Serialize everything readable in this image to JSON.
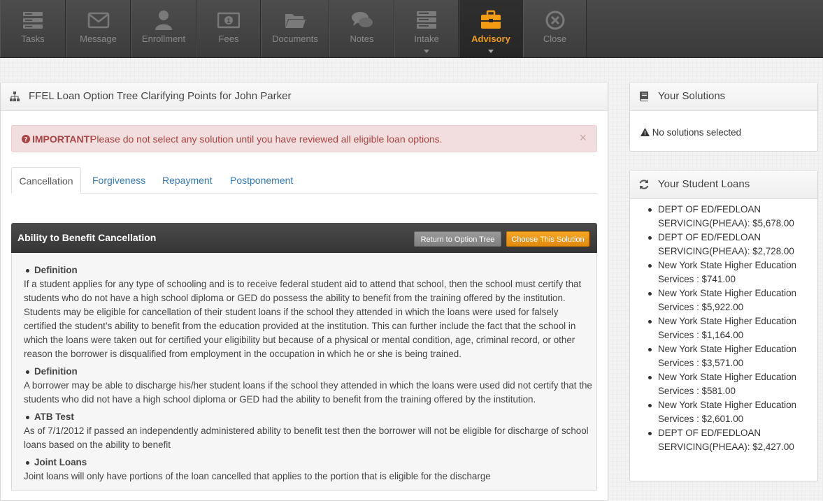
{
  "nav": {
    "items": [
      {
        "label": "Tasks",
        "icon": "tasks-icon"
      },
      {
        "label": "Message",
        "icon": "envelope-icon"
      },
      {
        "label": "Enrollment",
        "icon": "user-icon"
      },
      {
        "label": "Fees",
        "icon": "money-icon"
      },
      {
        "label": "Documents",
        "icon": "folder-icon"
      },
      {
        "label": "Notes",
        "icon": "comments-icon"
      },
      {
        "label": "Intake",
        "icon": "server-icon"
      },
      {
        "label": "Advisory",
        "icon": "briefcase-icon"
      },
      {
        "label": "Close",
        "icon": "close-circle-icon"
      }
    ],
    "active": "Advisory",
    "active_color": "#f39c12"
  },
  "main": {
    "title": "FFEL Loan Option Tree Clarifying Points for John Parker",
    "alert": {
      "strong": "IMPORTANT!",
      "message": "Please do not select any solution until you have reviewed all eligible loan options.",
      "close": "×"
    },
    "tabs": [
      "Cancellation",
      "Forgiveness",
      "Repayment",
      "Postponement"
    ],
    "active_tab": "Cancellation",
    "solution": {
      "title": "Ability to Benefit Cancellation",
      "return_label": "Return to Option Tree",
      "choose_label": "Choose This Solution",
      "sections": [
        {
          "heading": "Definition",
          "text": "If a student applies for any type of schooling and is to receive federal student aid to attend that school, then the school must certify that students who do not have a high school diploma or GED do possess the ability to benefit from the training offered by the institution. Students may be eligible for cancellation of their student loans if the school they attended in which the loans were used for falsely certified the student’s ability to benefit from the education provided at the institution. This can further include the fact that the school in which the loans were taken out for certified your eligibility but because of a physical or mental condition, age, criminal record, or other reason the borrower is disqualified from employment in the occupation in which he or she is being trained."
        },
        {
          "heading": "Definition",
          "text": "A borrower may be able to discharge his/her student loans if the school they attended in which the loans were used did not certify that the students who did not have a high school diploma or GED had the ability to benefit from the training offered by the institution."
        },
        {
          "heading": "ATB Test",
          "text": "As of 7/1/2012 if passed an independently administered ability to benefit test then the borrower will not be eligible for discharge of school loans based on the ability to benefit"
        },
        {
          "heading": "Joint Loans",
          "text": "Joint loans will only have portions of the loan cancelled that applies to the portion that is eligible for the discharge"
        }
      ]
    }
  },
  "sidebar": {
    "solutions_title": "Your Solutions",
    "no_solutions": "No solutions selected",
    "loans_title": "Your Student Loans",
    "loans": [
      {
        "name": "DEPT OF ED/FEDLOAN SERVICING(PHEAA):",
        "amount": "$5,678.00"
      },
      {
        "name": "DEPT OF ED/FEDLOAN SERVICING(PHEAA):",
        "amount": "$2,728.00"
      },
      {
        "name": "New York State Higher Education Services :",
        "amount": "$741.00"
      },
      {
        "name": "New York State Higher Education Services :",
        "amount": "$5,922.00"
      },
      {
        "name": "New York State Higher Education Services :",
        "amount": "$1,164.00"
      },
      {
        "name": "New York State Higher Education Services :",
        "amount": "$3,571.00"
      },
      {
        "name": "New York State Higher Education Services :",
        "amount": "$581.00"
      },
      {
        "name": "New York State Higher Education Services :",
        "amount": "$2,601.00"
      },
      {
        "name": "DEPT OF ED/FEDLOAN SERVICING(PHEAA):",
        "amount": "$2,427.00"
      }
    ]
  }
}
